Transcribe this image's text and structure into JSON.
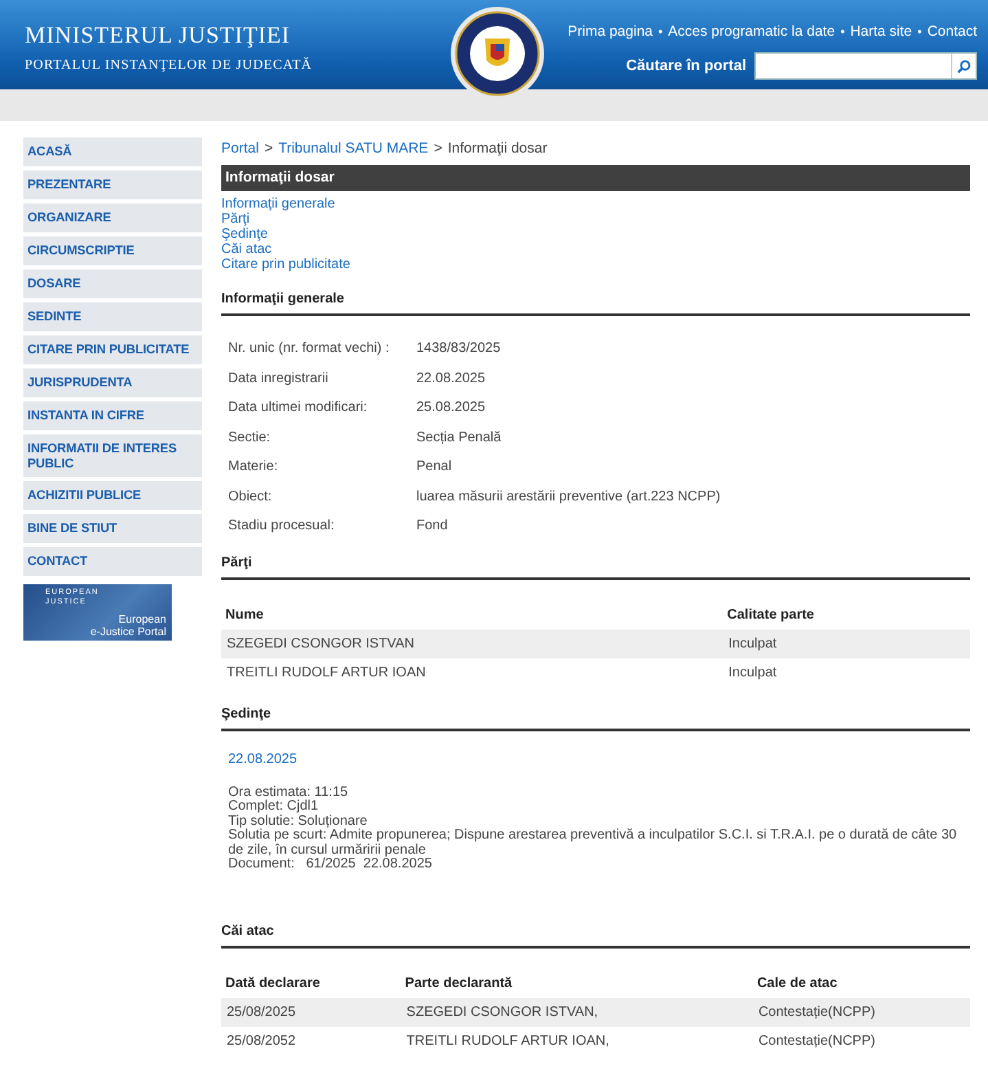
{
  "header": {
    "title": "MINISTERUL JUSTIŢIEI",
    "subtitle": "PORTALUL INSTANŢELOR DE JUDECATĂ",
    "links": [
      "Prima pagina",
      "Acces programatic la date",
      "Harta site",
      "Contact"
    ],
    "search_label": "Căutare în portal",
    "link_separator": "•"
  },
  "sidebar": {
    "items": [
      "ACASĂ",
      "PREZENTARE",
      "ORGANIZARE",
      "CIRCUMSCRIPTIE",
      "DOSARE",
      "SEDINTE",
      "CITARE PRIN PUBLICITATE",
      "JURISPRUDENTA",
      "INSTANTA IN CIFRE",
      "INFORMATII DE INTERES PUBLIC",
      "ACHIZITII PUBLICE",
      "BINE DE STIUT",
      "CONTACT"
    ],
    "banner": {
      "top": "EUROPEAN JUSTICE",
      "line1": "European",
      "line2": "e-Justice Portal"
    }
  },
  "breadcrumb_separator": ">",
  "breadcrumb": [
    {
      "label": "Portal",
      "link": true
    },
    {
      "label": "Tribunalul SATU MARE",
      "link": true
    },
    {
      "label": "Informaţii dosar",
      "link": false
    }
  ],
  "page_title": "Informaţii dosar",
  "anchors": [
    "Informaţii generale",
    "Părţi",
    "Şedinţe",
    "Căi atac",
    "Citare prin publicitate"
  ],
  "general": {
    "title": "Informaţii generale",
    "fields": [
      {
        "label": "Nr. unic (nr. format vechi) :",
        "value": "1438/83/2025"
      },
      {
        "label": "Data inregistrarii",
        "value": "22.08.2025"
      },
      {
        "label": "Data ultimei modificari:",
        "value": "25.08.2025"
      },
      {
        "label": "Sectie:",
        "value": "Secția Penală"
      },
      {
        "label": "Materie:",
        "value": "Penal"
      },
      {
        "label": "Obiect:",
        "value": "luarea măsurii arestării preventive (art.223 NCPP)"
      },
      {
        "label": "Stadiu procesual:",
        "value": "Fond"
      }
    ]
  },
  "parti": {
    "title": "Părţi",
    "columns": [
      "Nume",
      "Calitate parte"
    ],
    "rows": [
      [
        "SZEGEDI CSONGOR ISTVAN",
        "Inculpat"
      ],
      [
        "TREITLI RUDOLF ARTUR IOAN",
        "Inculpat"
      ]
    ]
  },
  "sedinte": {
    "title": "Şedinţe",
    "entries": [
      {
        "date": "22.08.2025",
        "lines": [
          "Ora estimata: 11:15",
          "Complet: Cjdl1",
          "Tip solutie: Soluționare",
          "Solutia pe scurt: Admite propunerea; Dispune arestarea preventivă a inculpatilor S.C.I. si T.R.A.I. pe o durată de câte 30 de zile, în cursul urmăririi penale",
          "Document:   61/2025  22.08.2025"
        ]
      }
    ]
  },
  "cai_atac": {
    "title": "Căi atac",
    "columns": [
      "Dată declarare",
      "Parte declarantă",
      "Cale de atac"
    ],
    "rows": [
      [
        "25/08/2025",
        "SZEGEDI CSONGOR ISTVAN,",
        "Contestație(NCPP)"
      ],
      [
        "25/08/2052",
        "TREITLI RUDOLF ARTUR IOAN,",
        "Contestație(NCPP)"
      ]
    ]
  }
}
